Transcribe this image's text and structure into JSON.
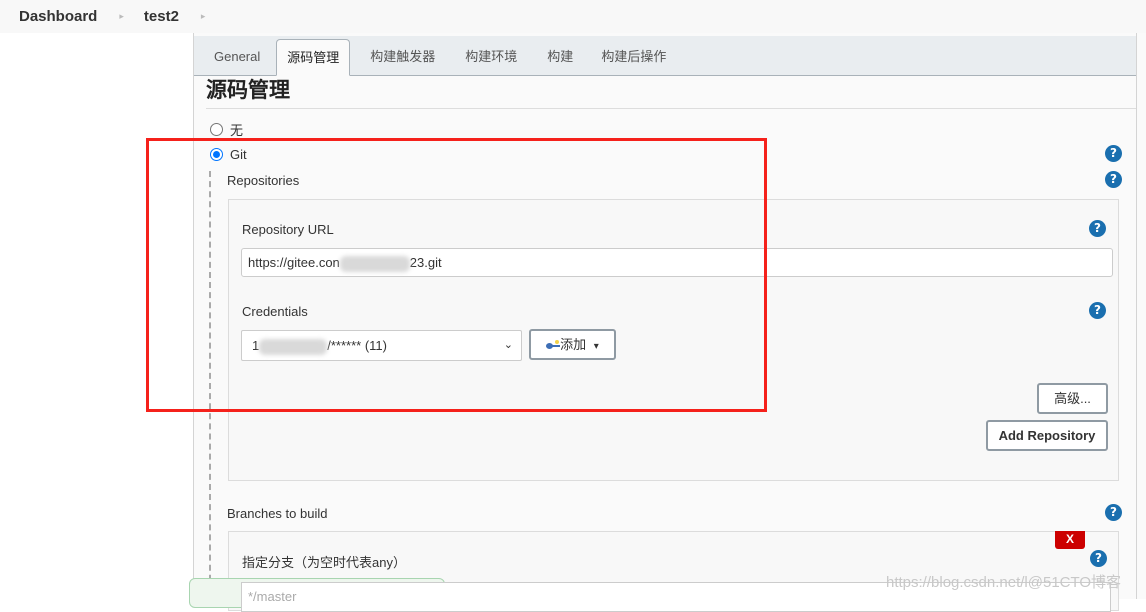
{
  "breadcrumb": {
    "items": [
      "Dashboard",
      "test2"
    ]
  },
  "tabs": [
    {
      "label": "General",
      "active": false
    },
    {
      "label": "源码管理",
      "active": true
    },
    {
      "label": "构建触发器",
      "active": false
    },
    {
      "label": "构建环境",
      "active": false
    },
    {
      "label": "构建",
      "active": false
    },
    {
      "label": "构建后操作",
      "active": false
    }
  ],
  "section": {
    "title": "源码管理",
    "options": [
      {
        "label": "无",
        "selected": false
      },
      {
        "label": "Git",
        "selected": true
      }
    ]
  },
  "git": {
    "repositories_label": "Repositories",
    "repository_url_label": "Repository URL",
    "repository_url_prefix": "https://gitee.con",
    "repository_url_suffix": "23.git",
    "credentials_label": "Credentials",
    "credentials_prefix": "1",
    "credentials_suffix": "/****** (11)",
    "add_button_label": "添加",
    "advanced_button_label": "高级...",
    "add_repository_label": "Add Repository",
    "branches_label": "Branches to build",
    "branch_specifier_label": "指定分支（为空时代表any）",
    "branch_value": "*/master",
    "delete_label": "X"
  },
  "icons": {
    "help": "?",
    "breadcrumb_separator": "▸",
    "dropdown_chevron": "⌄",
    "caret": "▾"
  },
  "watermark": "https://blog.csdn.net/l@51CTO博客",
  "colors": {
    "help_icon": "#1a6faf",
    "radio_selected": "#0075ff",
    "delete_button": "#cc0000",
    "annotation_frame": "#f5211b"
  }
}
